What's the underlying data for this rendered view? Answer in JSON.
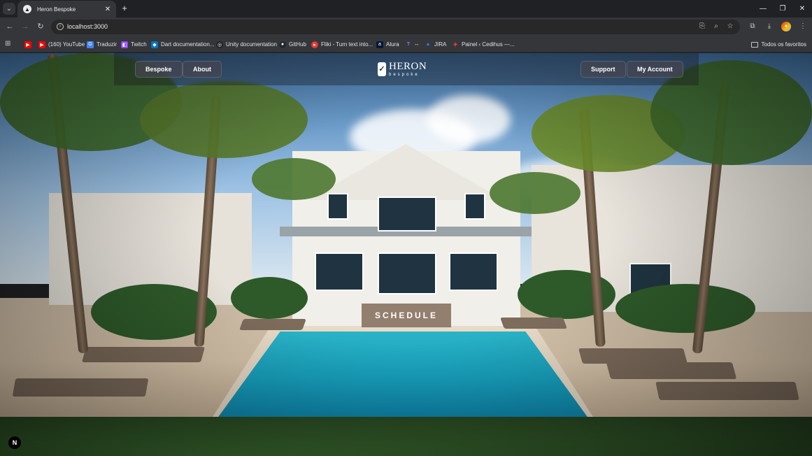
{
  "browser": {
    "tab_title": "Heron Bespoke",
    "url": "localhost:3000",
    "bookmarks": [
      {
        "label": "",
        "icon": "youtube-icon",
        "color": "#ff0000"
      },
      {
        "label": "(160) YouTube",
        "icon": "youtube-icon",
        "color": "#ff0000"
      },
      {
        "label": "Traduzir",
        "icon": "translate-icon",
        "color": "#4285f4"
      },
      {
        "label": "Twitch",
        "icon": "twitch-icon",
        "color": "#9146ff"
      },
      {
        "label": "Dart documentation...",
        "icon": "dart-icon",
        "color": "#0175c2"
      },
      {
        "label": "Unity documentation",
        "icon": "unity-icon",
        "color": "#222222"
      },
      {
        "label": "GitHub",
        "icon": "github-icon",
        "color": "#24292f"
      },
      {
        "label": "Fliki - Turn text into...",
        "icon": "fliki-icon",
        "color": "#e53935"
      },
      {
        "label": "Alura",
        "icon": "alura-icon",
        "color": "#051933"
      },
      {
        "label": "--",
        "icon": "t-icon",
        "color": "#7b3fe4"
      },
      {
        "label": "JIRA",
        "icon": "jira-icon",
        "color": "#2684ff"
      },
      {
        "label": "Painel ‹ Cedihus —...",
        "icon": "plus-icon",
        "color": "#e53935"
      }
    ],
    "all_bookmarks_label": "Todos os favoritos"
  },
  "site": {
    "nav": {
      "bespoke": "Bespoke",
      "about": "About",
      "support": "Support",
      "account": "My Account"
    },
    "logo": {
      "name": "HERON",
      "sub": "bespoke"
    },
    "cta": "SCHEDULE",
    "badge": "N"
  }
}
